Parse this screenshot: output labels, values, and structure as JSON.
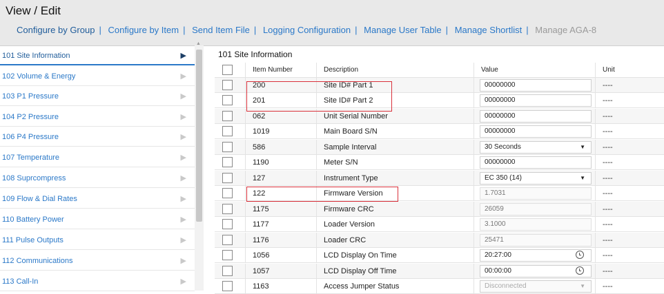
{
  "window": {
    "title": "View / Edit"
  },
  "tabs": [
    {
      "label": "Configure by Group"
    },
    {
      "label": "Configure by Item"
    },
    {
      "label": "Send Item File"
    },
    {
      "label": "Logging Configuration"
    },
    {
      "label": "Manage User Table"
    },
    {
      "label": "Manage Shortlist"
    },
    {
      "label": "Manage AGA-8"
    }
  ],
  "sidebar": {
    "items": [
      {
        "label": "101  Site Information"
      },
      {
        "label": "102  Volume & Energy"
      },
      {
        "label": "103  P1 Pressure"
      },
      {
        "label": "104  P2 Pressure"
      },
      {
        "label": "106  P4 Pressure"
      },
      {
        "label": "107  Temperature"
      },
      {
        "label": "108  Suprcompress"
      },
      {
        "label": "109  Flow & Dial Rates"
      },
      {
        "label": "110  Battery Power"
      },
      {
        "label": "111  Pulse Outputs"
      },
      {
        "label": "112  Communications"
      },
      {
        "label": "113  Call-In"
      }
    ]
  },
  "main": {
    "section_title": "101  Site Information",
    "columns": [
      "Item Number",
      "Description",
      "Value",
      "Unit"
    ],
    "rows": [
      {
        "item": "200",
        "desc": "Site ID# Part 1",
        "value": "00000000",
        "unit": "----"
      },
      {
        "item": "201",
        "desc": "Site ID# Part 2",
        "value": "00000000",
        "unit": "----"
      },
      {
        "item": "062",
        "desc": "Unit Serial Number",
        "value": "00000000",
        "unit": "----"
      },
      {
        "item": "1019",
        "desc": "Main Board S/N",
        "value": "00000000",
        "unit": "----"
      },
      {
        "item": "586",
        "desc": "Sample Interval",
        "value": "30 Seconds",
        "unit": "----"
      },
      {
        "item": "1190",
        "desc": "Meter S/N",
        "value": "00000000",
        "unit": "----"
      },
      {
        "item": "127",
        "desc": "Instrument Type",
        "value": "EC 350 (14)",
        "unit": "----"
      },
      {
        "item": "122",
        "desc": "Firmware Version",
        "value": "1.7031",
        "unit": "----"
      },
      {
        "item": "1175",
        "desc": "Firmware CRC",
        "value": "26059",
        "unit": "----"
      },
      {
        "item": "1177",
        "desc": "Loader Version",
        "value": "3.1000",
        "unit": "----"
      },
      {
        "item": "1176",
        "desc": "Loader CRC",
        "value": "25471",
        "unit": "----"
      },
      {
        "item": "1056",
        "desc": "LCD Display On Time",
        "value": "20:27:00",
        "unit": "----"
      },
      {
        "item": "1057",
        "desc": "LCD Display Off Time",
        "value": "00:00:00",
        "unit": "----"
      },
      {
        "item": "1163",
        "desc": "Access Jumper Status",
        "value": "Disconnected",
        "unit": "----"
      }
    ]
  },
  "icons": {
    "row_arrow": "chevron-right-icon",
    "time": "alarm-clock-icon",
    "dropdown": "caret-down-icon"
  },
  "colors": {
    "accent": "#2a78c8",
    "highlight": "#d9303a"
  }
}
